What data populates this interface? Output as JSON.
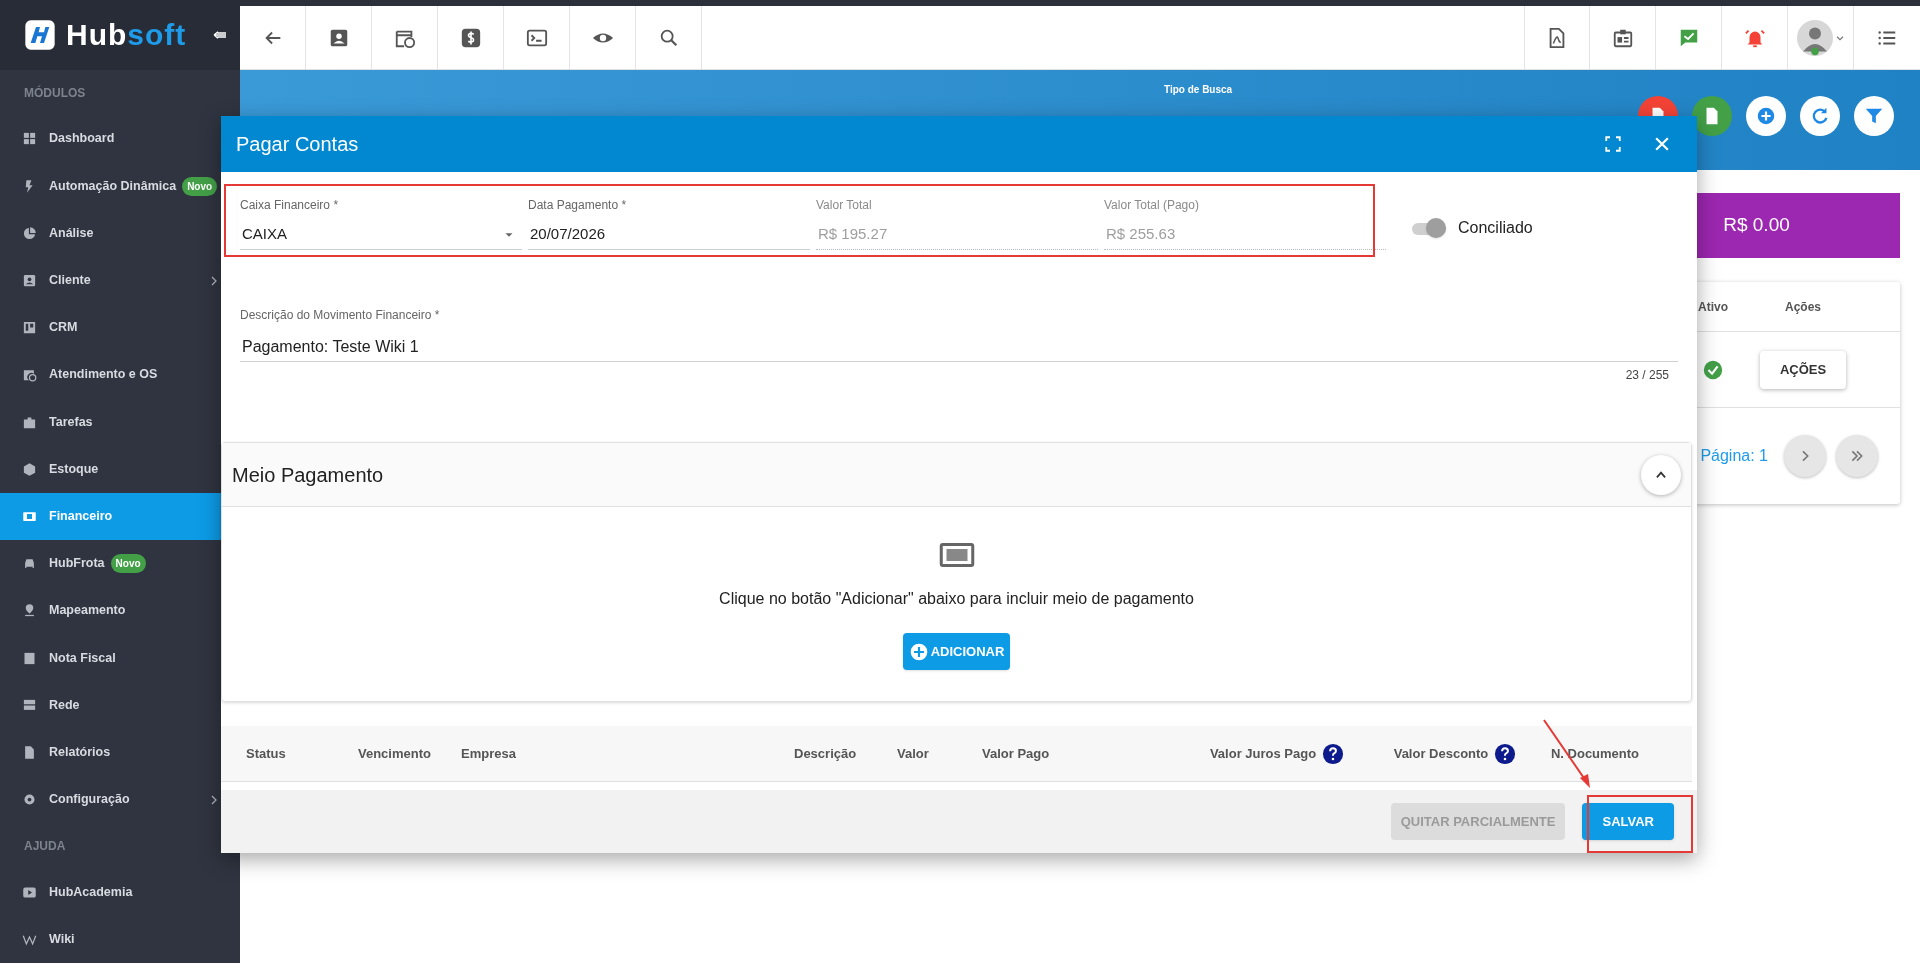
{
  "sidebar": {
    "logo": {
      "brand_first": "Hub",
      "brand_second": "soft"
    },
    "sections": [
      {
        "title": "MÓDULOS",
        "items": [
          {
            "label": "Dashboard",
            "selected": false,
            "has_submenu": false
          },
          {
            "label": "Automação Dinâmica",
            "badge": "Novo",
            "selected": false,
            "has_submenu": false
          },
          {
            "label": "Análise",
            "selected": false,
            "has_submenu": false
          },
          {
            "label": "Cliente",
            "selected": false,
            "has_submenu": true
          },
          {
            "label": "CRM",
            "selected": false,
            "has_submenu": false
          },
          {
            "label": "Atendimento e OS",
            "selected": false,
            "has_submenu": false
          },
          {
            "label": "Tarefas",
            "selected": false,
            "has_submenu": false
          },
          {
            "label": "Estoque",
            "selected": false,
            "has_submenu": false
          },
          {
            "label": "Financeiro",
            "selected": true,
            "has_submenu": false
          },
          {
            "label": "HubFrota",
            "badge": "Novo",
            "selected": false,
            "has_submenu": false
          },
          {
            "label": "Mapeamento",
            "selected": false,
            "has_submenu": false
          },
          {
            "label": "Nota Fiscal",
            "selected": false,
            "has_submenu": false
          },
          {
            "label": "Rede",
            "selected": false,
            "has_submenu": false
          },
          {
            "label": "Relatórios",
            "selected": false,
            "has_submenu": false
          },
          {
            "label": "Configuração",
            "selected": false,
            "has_submenu": true
          }
        ]
      },
      {
        "title": "AJUDA",
        "items": [
          {
            "label": "HubAcademia",
            "selected": false,
            "has_submenu": false
          },
          {
            "label": "Wiki",
            "selected": false,
            "has_submenu": false
          }
        ]
      }
    ]
  },
  "banner": {
    "search_type_label": "Tipo de Busca"
  },
  "summary_card": {
    "amount": "R$ 0.00"
  },
  "results_table": {
    "columns": [
      "Ativo",
      "Ações"
    ],
    "rows": [
      {
        "active": true,
        "action": "AÇÕES"
      }
    ],
    "pagination": "Página: 1"
  },
  "modal": {
    "title": "Pagar Contas",
    "fields": [
      {
        "kind": "select",
        "label": "Caixa Financeiro *",
        "value": "CAIXA",
        "disabled": false
      },
      {
        "kind": "text",
        "label": "Data Pagamento *",
        "value": "20/07/2026",
        "disabled": false
      },
      {
        "kind": "text",
        "label": "Valor Total",
        "value": "R$ 195.27",
        "disabled": true
      },
      {
        "kind": "text",
        "label": "Valor Total (Pago)",
        "value": "R$ 255.63",
        "disabled": true
      }
    ],
    "conciliado": {
      "label": "Conciliado",
      "on": false
    },
    "description": {
      "label": "Descrição do Movimento Financeiro *",
      "value": "Pagamento: Teste Wiki 1",
      "counter": "23 / 255"
    },
    "payment_panel": {
      "title": "Meio Pagamento",
      "expanded": true,
      "empty_message": "Clique no botão \"Adicionar\" abaixo para incluir meio de pagamento",
      "add_button": "ADICIONAR"
    },
    "table_columns": [
      {
        "label": "Status",
        "help": false
      },
      {
        "label": "Vencimento",
        "help": false
      },
      {
        "label": "Empresa",
        "help": false
      },
      {
        "label": "Descrição",
        "help": false
      },
      {
        "label": "Valor",
        "help": false
      },
      {
        "label": "Valor Pago",
        "help": false
      },
      {
        "label": "Valor Juros Pago",
        "help": true
      },
      {
        "label": "Valor Desconto",
        "help": true
      },
      {
        "label": "N. Documento",
        "help": false
      }
    ],
    "buttons": [
      {
        "label": "QUITAR PARCIALMENTE",
        "disabled": true
      },
      {
        "label": "SALVAR",
        "disabled": false
      }
    ]
  }
}
